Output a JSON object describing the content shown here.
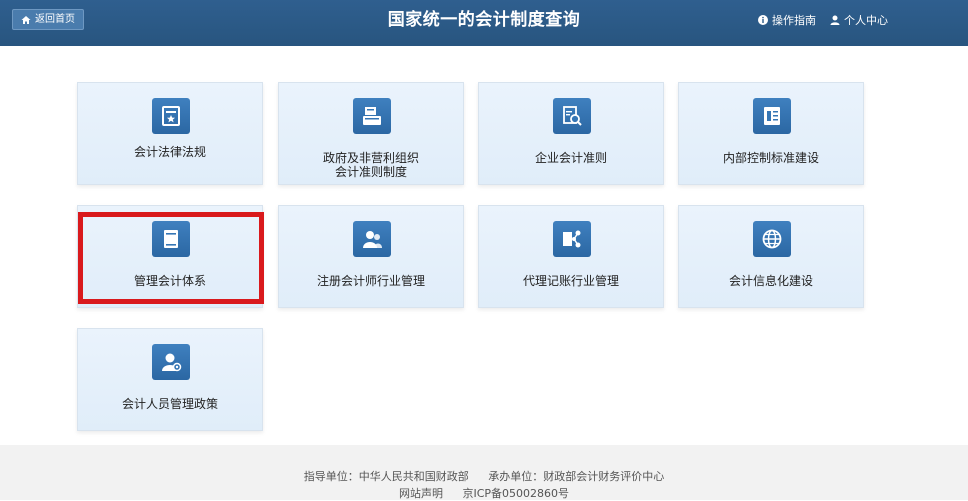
{
  "header": {
    "home_button": "返回首页",
    "title": "国家统一的会计制度查询",
    "guide_link": "操作指南",
    "user_link": "个人中心"
  },
  "tiles": [
    {
      "label": "会计法律法规",
      "icon": "law-book-icon"
    },
    {
      "label": "政府及非营利组织\n会计准则制度",
      "icon": "document-stack-icon"
    },
    {
      "label": "企业会计准则",
      "icon": "document-search-icon"
    },
    {
      "label": "内部控制标准建设",
      "icon": "report-list-icon"
    },
    {
      "label": "管理会计体系",
      "icon": "book-icon"
    },
    {
      "label": "注册会计师行业管理",
      "icon": "people-icon"
    },
    {
      "label": "代理记账行业管理",
      "icon": "share-network-icon"
    },
    {
      "label": "会计信息化建设",
      "icon": "globe-icon"
    },
    {
      "label": "会计人员管理政策",
      "icon": "user-gear-icon"
    }
  ],
  "footer": {
    "guide_unit": "指导单位：中华人民共和国财政部",
    "host_unit": "承办单位：财政部会计财务评价中心",
    "statement": "网站声明",
    "icp": "京ICP备05002860号"
  },
  "colors": {
    "header_bg": "#2b5a88",
    "tile_bg": "#e5f0fb",
    "icon_bg": "#3576b5",
    "highlight": "#d9191c"
  }
}
